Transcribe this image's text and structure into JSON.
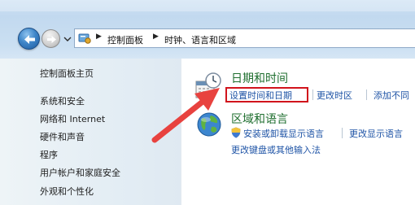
{
  "breadcrumb": {
    "items": [
      "控制面板",
      "时钟、语言和区域"
    ]
  },
  "sidebar": {
    "home": "控制面板主页",
    "items": [
      {
        "label": "系统和安全"
      },
      {
        "label": "网络和 Internet"
      },
      {
        "label": "硬件和声音"
      },
      {
        "label": "程序"
      },
      {
        "label": "用户帐户和家庭安全"
      },
      {
        "label": "外观和个性化"
      }
    ]
  },
  "categories": [
    {
      "title": "日期和时间",
      "links": [
        "设置时间和日期",
        "更改时区",
        "添加不同"
      ]
    },
    {
      "title": "区域和语言",
      "links": [
        "安装或卸载显示语言",
        "更改显示语言",
        "更改键盘或其他输入法"
      ]
    }
  ],
  "colors": {
    "category_title": "#1e6e2e",
    "link": "#1f54a6",
    "highlight": "#d1141c",
    "arrow": "#e8423f"
  }
}
